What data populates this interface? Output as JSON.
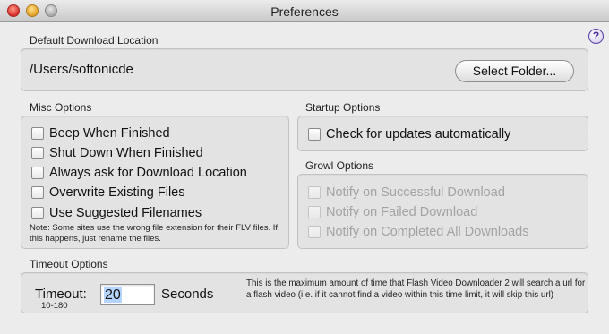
{
  "window": {
    "title": "Preferences"
  },
  "help_glyph": "?",
  "download": {
    "section_label": "Default Download Location",
    "path": "/Users/softonicde",
    "select_button": "Select Folder..."
  },
  "misc": {
    "section_label": "Misc Options",
    "options": [
      {
        "label": "Beep When Finished",
        "checked": false
      },
      {
        "label": "Shut Down When Finished",
        "checked": false
      },
      {
        "label": "Always ask for Download Location",
        "checked": false
      },
      {
        "label": "Overwrite Existing Files",
        "checked": false
      },
      {
        "label": "Use Suggested Filenames",
        "checked": false
      }
    ],
    "note": "Note: Some sites use the wrong file extension for their FLV files.  If this happens, just rename the files."
  },
  "startup": {
    "section_label": "Startup Options",
    "check_updates": {
      "label": "Check for updates automatically",
      "checked": false
    }
  },
  "growl": {
    "section_label": "Growl Options",
    "options": [
      {
        "label": "Notify on Successful Download",
        "checked": false,
        "enabled": false
      },
      {
        "label": "Notify on Failed Download",
        "checked": false,
        "enabled": false
      },
      {
        "label": "Notify on Completed All Downloads",
        "checked": false,
        "enabled": false
      }
    ]
  },
  "timeout": {
    "section_label": "Timeout Options",
    "label": "Timeout:",
    "range": "10-180",
    "value": "20",
    "unit": "Seconds",
    "description": "This is the maximum amount of time that Flash Video Downloader 2 will search a url for a flash video (i.e. if it cannot find a video within this time limit, it will skip this url)"
  }
}
